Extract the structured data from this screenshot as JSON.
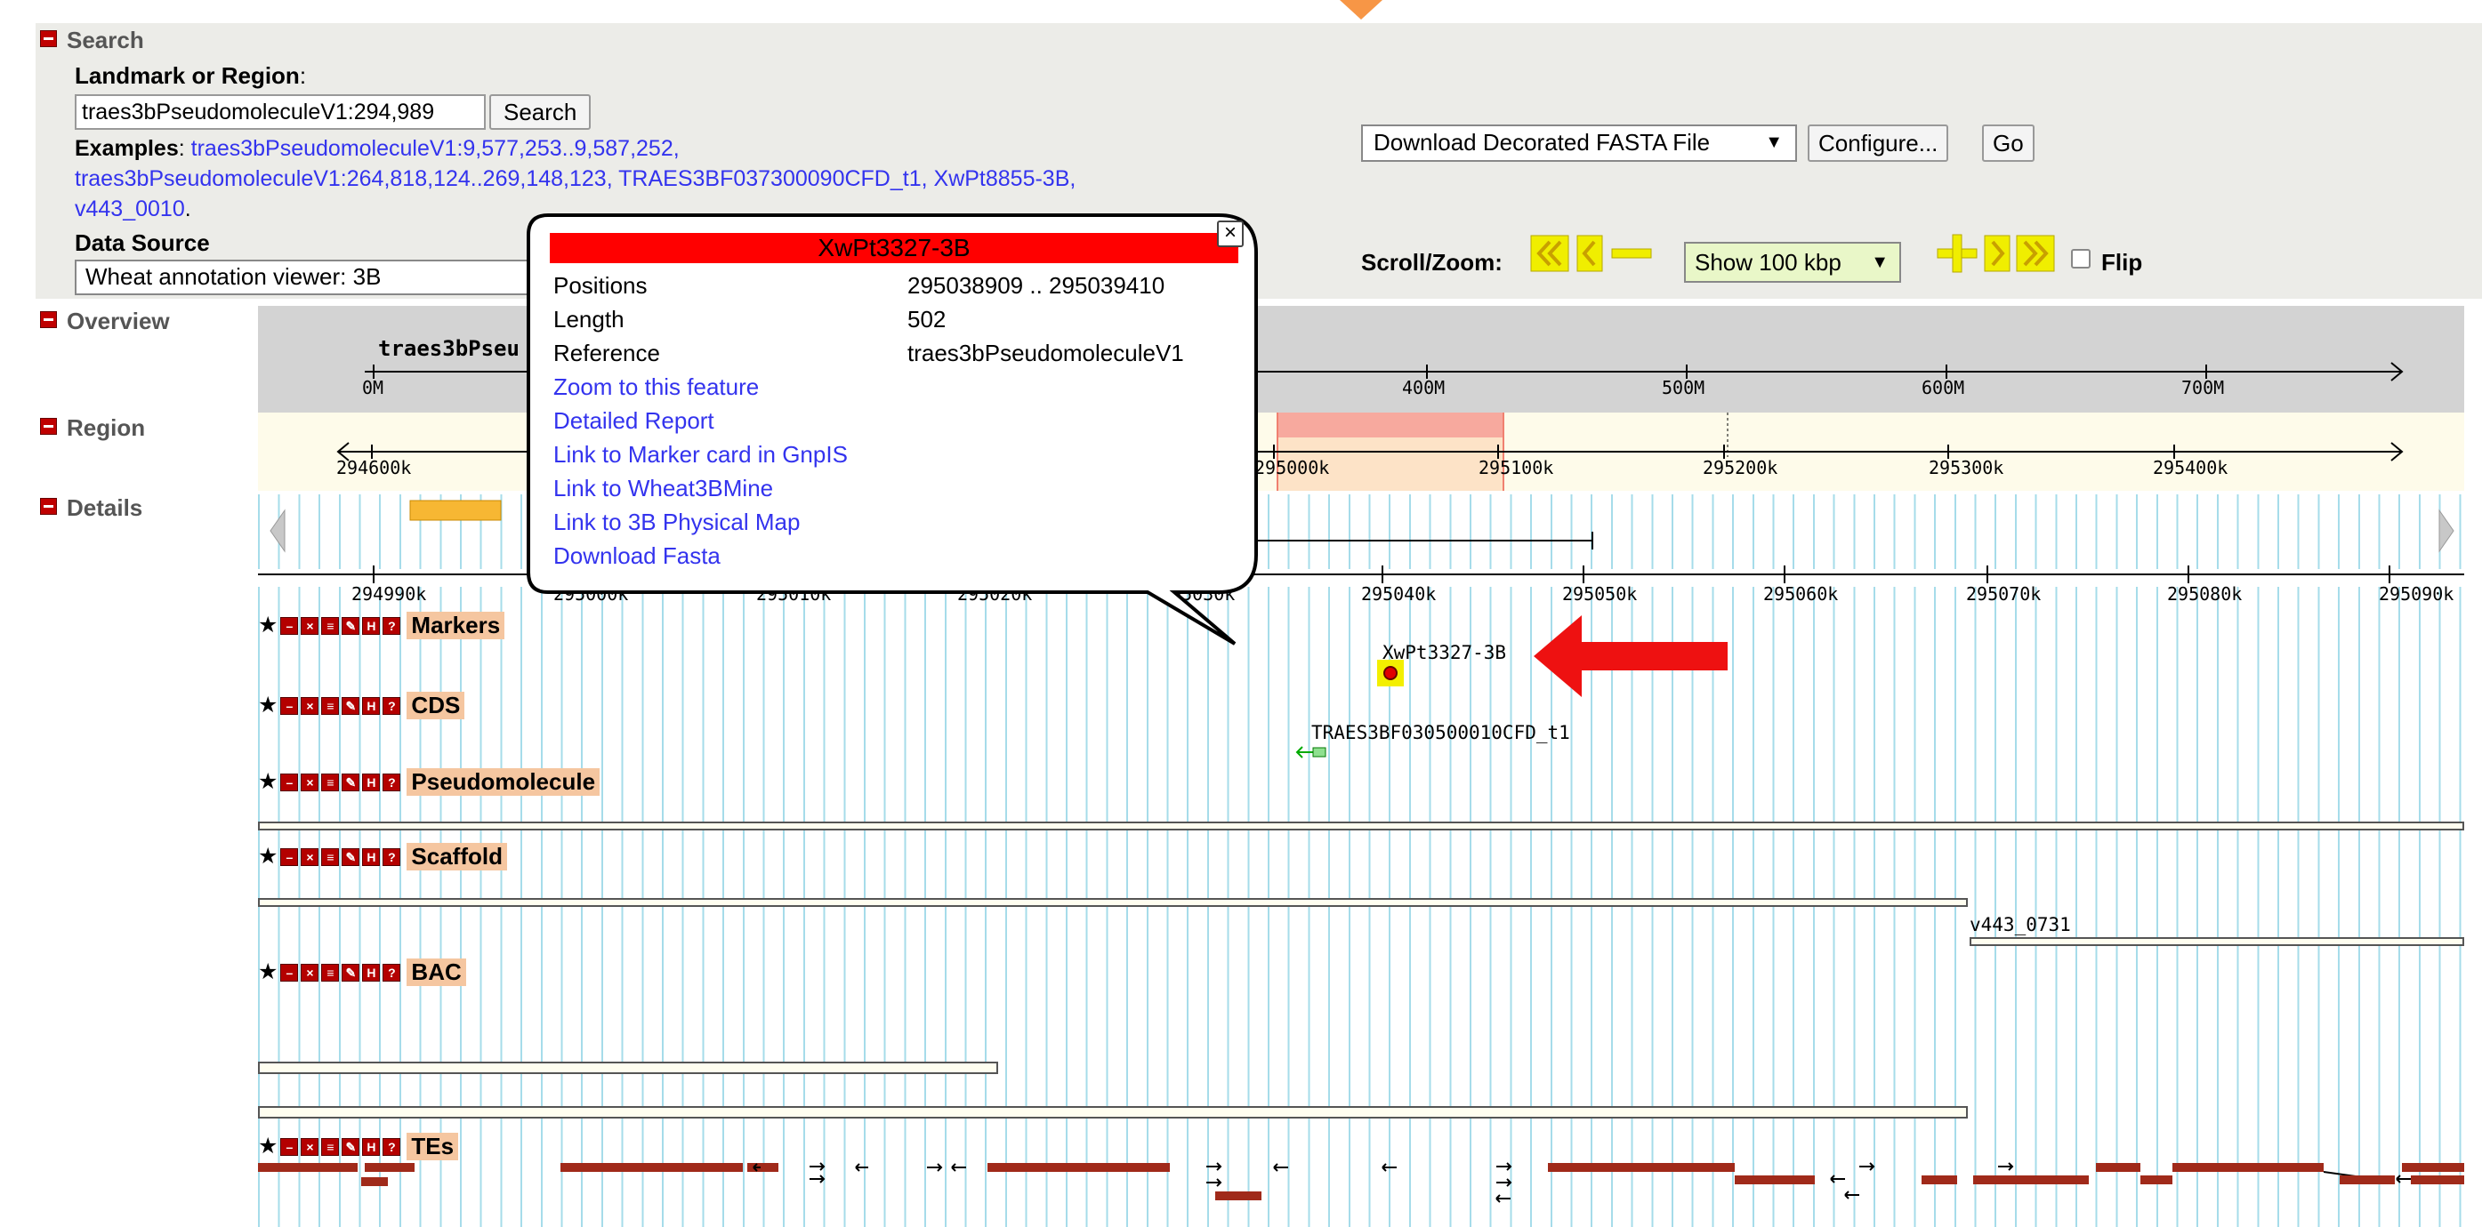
{
  "search": {
    "section_title": "Search",
    "landmark_label": "Landmark or Region",
    "landmark_colon": ":",
    "input_value": "traes3bPseudomoleculeV1:294,989",
    "search_button": "Search",
    "examples_label": "Examples",
    "examples_colon": ":",
    "examples": [
      "traes3bPseudomoleculeV1:9,577,253..9,587,252,",
      "traes3bPseudomoleculeV1:264,818,124..269,148,123,",
      "TRAES3BF037300090CFD_t1,",
      "XwPt8855-3B,",
      "v443_0010"
    ],
    "examples_end": ".",
    "data_source_label": "Data Source",
    "data_source_value": "Wheat annotation viewer: 3B"
  },
  "toolbar": {
    "download_option": "Download Decorated FASTA File",
    "configure_button": "Configure...",
    "go_button": "Go",
    "scroll_zoom_label": "Scroll/Zoom:",
    "zoom_value": "Show 100 kbp",
    "flip_label": "Flip"
  },
  "overview": {
    "section_title": "Overview",
    "chrom_label": "traes3bPseu",
    "ticks": [
      "0M",
      "400M",
      "500M",
      "600M",
      "700M"
    ]
  },
  "region": {
    "section_title": "Region",
    "ticks": [
      "294600k",
      "295000k",
      "295100k",
      "295200k",
      "295300k",
      "295400k"
    ]
  },
  "details": {
    "section_title": "Details",
    "ticks": [
      "294990k",
      "295000k",
      "295010k",
      "295020k",
      "295030k",
      "295040k",
      "295050k",
      "295060k",
      "295070k",
      "295080k",
      "295090k"
    ]
  },
  "tracks": [
    {
      "name": "Markers"
    },
    {
      "name": "CDS"
    },
    {
      "name": "Pseudomolecule"
    },
    {
      "name": "Scaffold"
    },
    {
      "name": "BAC"
    },
    {
      "name": "TEs"
    }
  ],
  "features": {
    "marker_label": "XwPt3327-3B",
    "cds_label": "TRAES3BF030500010CFD_t1",
    "bac_label": "v443_0731"
  },
  "popup": {
    "title": "XwPt3327-3B",
    "rows": [
      {
        "key": "Positions",
        "value": "295038909 .. 295039410"
      },
      {
        "key": "Length",
        "value": "502"
      },
      {
        "key": "Reference",
        "value": "traes3bPseudomoleculeV1"
      }
    ],
    "links": [
      "Zoom to this feature",
      "Detailed Report",
      "Link to Marker card in GnpIS",
      "Link to Wheat3BMine",
      "Link to 3B Physical Map",
      "Download Fasta"
    ],
    "close_symbol": "×"
  },
  "colors": {
    "popup_title_bg": "#ff0000",
    "link": "#3333ee",
    "arrow": "#ee1111",
    "orange_marker": "#f79646",
    "te_feature": "#a02a1a"
  }
}
